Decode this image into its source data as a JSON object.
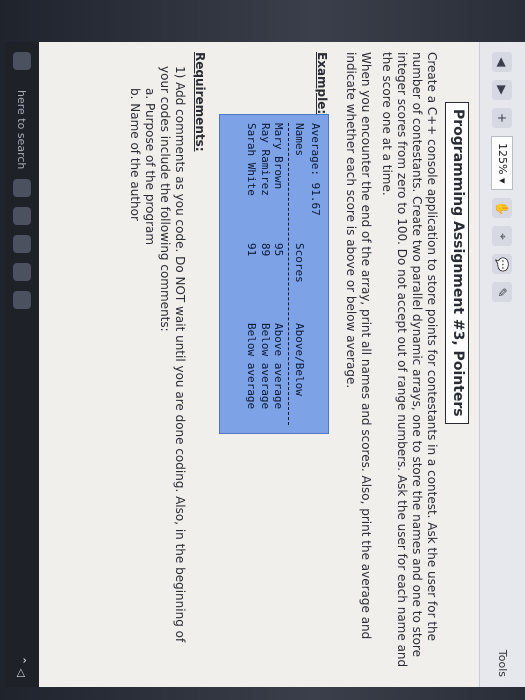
{
  "ribbon": {
    "zoom_label": "125%",
    "tools_label": "Tools"
  },
  "document": {
    "title": "Programming Assignment #3, Pointers",
    "paragraph1": "Create a C++ console application to store points for contestants in a contest. Ask the user for the number of contestants. Create two parallel dynamic arrays, one to store the names and one to store integer scores from zero to 100. Do not accept out of range numbers. Ask the user for each name and the score one at a time.",
    "paragraph2": "When you encounter the end of the array, print all names and scores. Also, print the average and indicate whether each score is above or below average.",
    "example_label": "Example:",
    "example": {
      "average": "Average: 91.67",
      "headers": [
        "Names",
        "Scores",
        "Above/Below"
      ],
      "rows": [
        [
          "Mary Brown",
          "95",
          "Above average"
        ],
        [
          "Ray Ramirez",
          "89",
          "Below average"
        ],
        [
          "Sarah White",
          "91",
          "Below average"
        ]
      ]
    },
    "requirements_title": "Requirements:",
    "requirements": [
      "1) Add comments as you code. Do NOT wait until you are done coding. Also, in the beginning of your codes include the following comments:",
      "a. Purpose of the program",
      "b. Name of the author"
    ]
  },
  "taskbar": {
    "search_label": "here to search"
  }
}
